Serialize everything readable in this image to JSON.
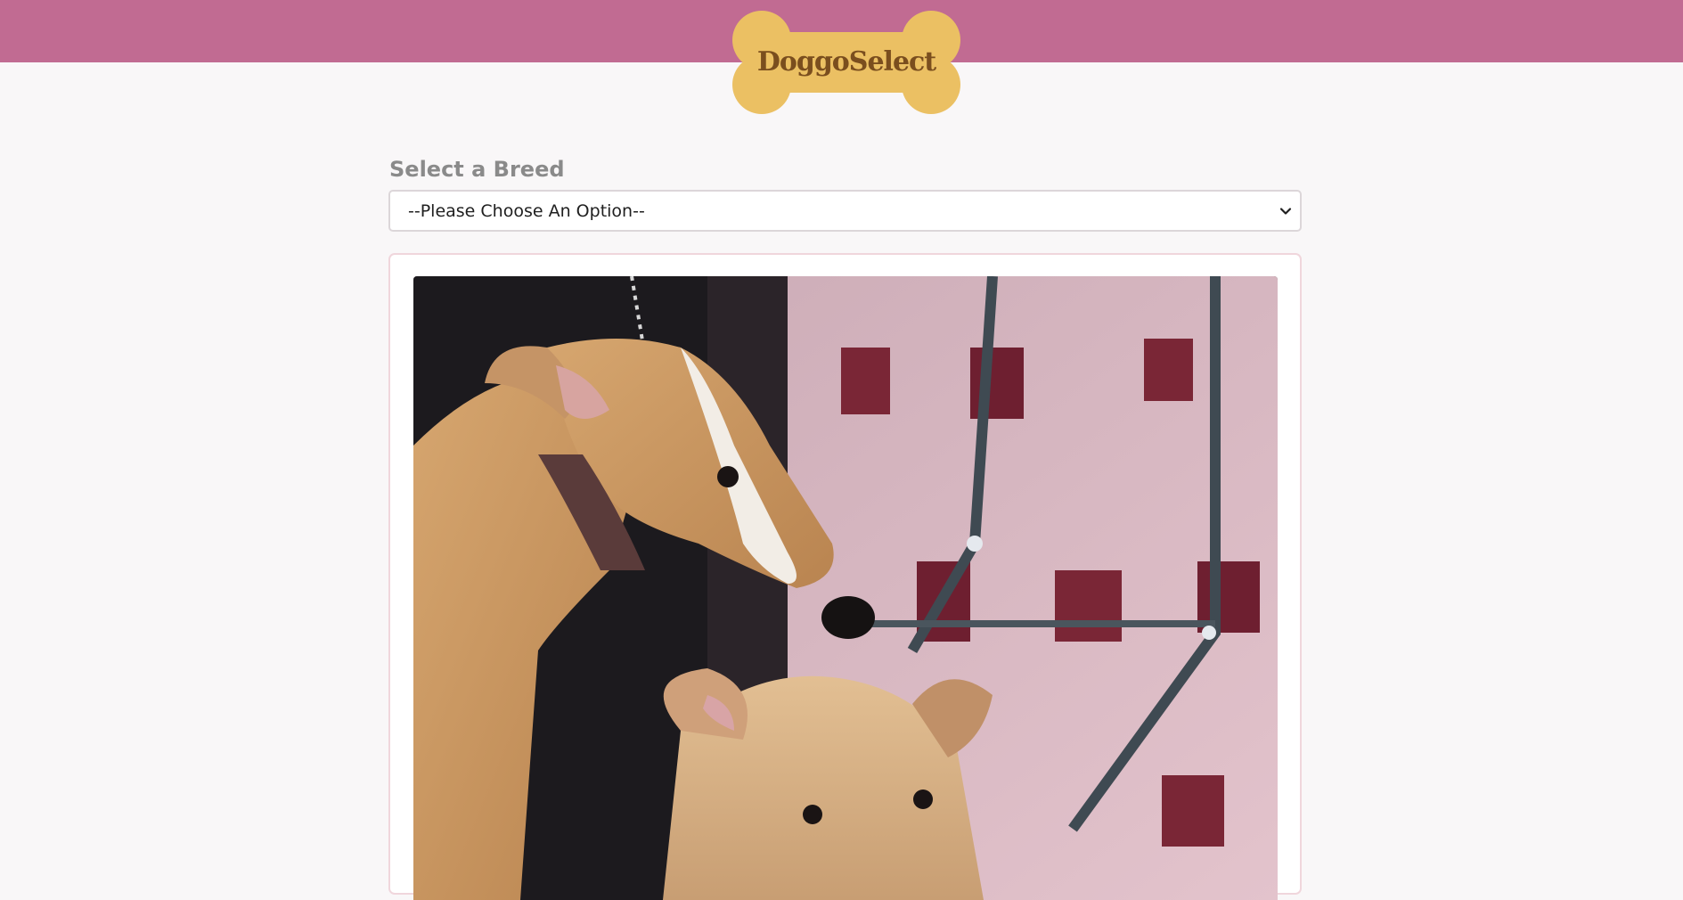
{
  "header": {
    "logo_text": "DoggoSelect",
    "bar_color": "#c16b92",
    "logo_color": "#ebc063"
  },
  "breed_selector": {
    "label": "Select a Breed",
    "selected_value": "--Please Choose An Option--",
    "chevron_icon": "chevron-down-icon"
  },
  "gallery": {
    "image_description_icon": "dog-photo"
  }
}
